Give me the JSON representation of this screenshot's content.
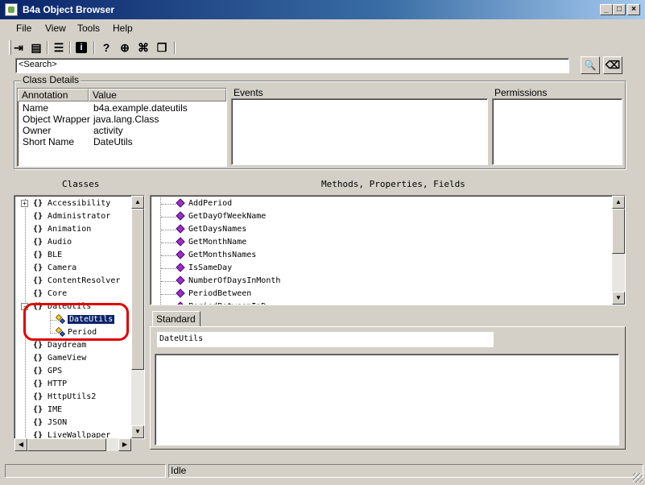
{
  "window": {
    "title": "B4a Object Browser",
    "min_label": "_",
    "max_label": "□",
    "close_label": "×"
  },
  "menu": [
    "File",
    "View",
    "Tools",
    "Help"
  ],
  "toolbar_icons": [
    "import-icon",
    "new-file-icon",
    "list-icon",
    "info-icon",
    "help-icon",
    "globe-icon",
    "gift-icon",
    "copy-icon"
  ],
  "toolbar_glyphs": [
    "⇥",
    "▤",
    "☰",
    "i",
    "?",
    "⊕",
    "⌘",
    "❐"
  ],
  "search": {
    "value": "<Search>",
    "search_glyph": "🔍",
    "clear_glyph": "⌫"
  },
  "class_details": {
    "legend": "Class Details",
    "columns": [
      "Annotation",
      "Value"
    ],
    "rows": [
      {
        "annotation": "Name",
        "value": "b4a.example.dateutils"
      },
      {
        "annotation": "Object Wrapper",
        "value": "java.lang.Class"
      },
      {
        "annotation": "Owner",
        "value": "activity"
      },
      {
        "annotation": "Short Name",
        "value": "DateUtils"
      }
    ]
  },
  "events": {
    "label": "Events"
  },
  "permissions": {
    "label": "Permissions"
  },
  "classes": {
    "label": "Classes",
    "items": [
      {
        "name": "Accessibility",
        "expand": "+"
      },
      {
        "name": "Administrator"
      },
      {
        "name": "Animation"
      },
      {
        "name": "Audio"
      },
      {
        "name": "BLE"
      },
      {
        "name": "Camera"
      },
      {
        "name": "ContentResolver"
      },
      {
        "name": "Core"
      },
      {
        "name": "DateUtils",
        "expand": "-"
      },
      {
        "name": "DateUtils",
        "child": true,
        "selected": true
      },
      {
        "name": "Period",
        "child": true
      },
      {
        "name": "Daydream"
      },
      {
        "name": "GameView"
      },
      {
        "name": "GPS"
      },
      {
        "name": "HTTP"
      },
      {
        "name": "HttpUtils2"
      },
      {
        "name": "IME"
      },
      {
        "name": "JSON"
      },
      {
        "name": "LiveWallpaper"
      }
    ],
    "braces": "{}"
  },
  "methods": {
    "label": "Methods, Properties, Fields",
    "items": [
      "AddPeriod",
      "GetDayOfWeekName",
      "GetDaysNames",
      "GetMonthName",
      "GetMonthsNames",
      "IsSameDay",
      "NumberOfDaysInMonth",
      "PeriodBetween",
      "PeriodBetweenInD..."
    ]
  },
  "detail": {
    "tab": "Standard",
    "signature": "DateUtils"
  },
  "status": {
    "text": "Idle"
  },
  "colors": {
    "highlight": "#0a246a",
    "annotation_circle": "#e00000",
    "method_icon": "#9b30c8"
  }
}
